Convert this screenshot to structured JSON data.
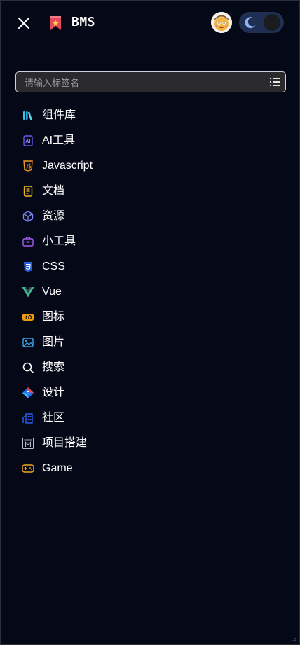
{
  "header": {
    "app_title": "BMS"
  },
  "search": {
    "placeholder": "请输入标签名"
  },
  "menu": {
    "items": [
      {
        "label": "组件库",
        "icon": "books-icon"
      },
      {
        "label": "AI工具",
        "icon": "ai-chip-icon"
      },
      {
        "label": "Javascript",
        "icon": "javascript-icon"
      },
      {
        "label": "文档",
        "icon": "document-icon"
      },
      {
        "label": "资源",
        "icon": "cube-icon"
      },
      {
        "label": "小工具",
        "icon": "toolbox-icon"
      },
      {
        "label": "CSS",
        "icon": "css3-icon"
      },
      {
        "label": "Vue",
        "icon": "vue-icon"
      },
      {
        "label": "图标",
        "icon": "ico-badge-icon"
      },
      {
        "label": "图片",
        "icon": "image-icon"
      },
      {
        "label": "搜索",
        "icon": "search-icon"
      },
      {
        "label": "设计",
        "icon": "design-diamond-icon"
      },
      {
        "label": "社区",
        "icon": "community-building-icon"
      },
      {
        "label": "项目搭建",
        "icon": "project-setup-icon"
      },
      {
        "label": "Game",
        "icon": "gamepad-icon"
      }
    ]
  },
  "colors": {
    "background": "#020617",
    "toggle_track": "#1e2f52",
    "moon": "#8fb4f5"
  }
}
